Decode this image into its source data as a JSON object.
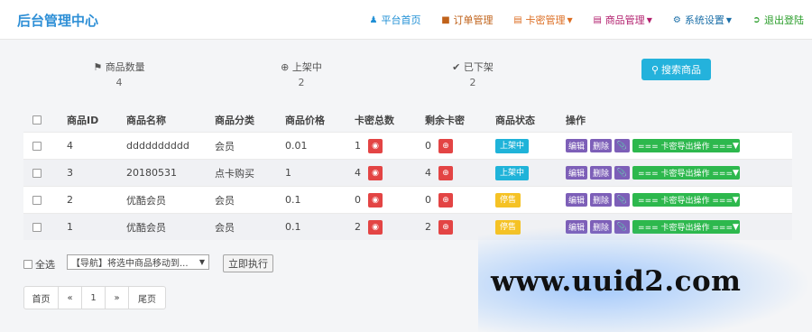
{
  "header": {
    "brand": "后台管理中心",
    "nav": [
      {
        "label": "平台首页",
        "icon": "user-icon",
        "color": "#1f8fd5",
        "caret": false
      },
      {
        "label": "订单管理",
        "icon": "briefcase-icon",
        "color": "#c0621a",
        "caret": false
      },
      {
        "label": "卡密管理",
        "icon": "card-icon",
        "color": "#dc6d22",
        "caret": true
      },
      {
        "label": "商品管理",
        "icon": "list-icon",
        "color": "#b21f6d",
        "caret": true
      },
      {
        "label": "系统设置",
        "icon": "gear-icon",
        "color": "#1b6fa8",
        "caret": true
      },
      {
        "label": "退出登陆",
        "icon": "logout-icon",
        "color": "#2a9d2a",
        "caret": false
      }
    ]
  },
  "stats": [
    {
      "label": "商品数量",
      "icon": "flag-icon",
      "value": "4"
    },
    {
      "label": "上架中",
      "icon": "plus-circle-icon",
      "value": "2"
    },
    {
      "label": "已下架",
      "icon": "check-icon",
      "value": "2"
    }
  ],
  "search_button": "搜索商品",
  "table": {
    "headers": [
      "商品ID",
      "商品名称",
      "商品分类",
      "商品价格",
      "卡密总数",
      "剩余卡密",
      "商品状态",
      "操作"
    ],
    "rows": [
      {
        "id": "4",
        "name": "dddddddddd",
        "category": "会员",
        "price": "0.01",
        "total": "1",
        "remain": "0",
        "status": "上架中",
        "status_type": "on"
      },
      {
        "id": "3",
        "name": "20180531",
        "category": "点卡购买",
        "price": "1",
        "total": "4",
        "remain": "4",
        "status": "上架中",
        "status_type": "on"
      },
      {
        "id": "2",
        "name": "优酷会员",
        "category": "会员",
        "price": "0.1",
        "total": "0",
        "remain": "0",
        "status": "停售",
        "status_type": "off"
      },
      {
        "id": "1",
        "name": "优酷会员",
        "category": "会员",
        "price": "0.1",
        "total": "2",
        "remain": "2",
        "status": "停售",
        "status_type": "off"
      }
    ],
    "edit_label": "编辑",
    "delete_label": "删除",
    "export_label": "=== 卡密导出操作 ==="
  },
  "footer": {
    "select_all": "全选",
    "move_select": "【导航】将选中商品移动到...",
    "execute": "立即执行"
  },
  "pager": [
    "首页",
    "«",
    "1",
    "»",
    "尾页"
  ],
  "watermark": "www.uuid2.com"
}
